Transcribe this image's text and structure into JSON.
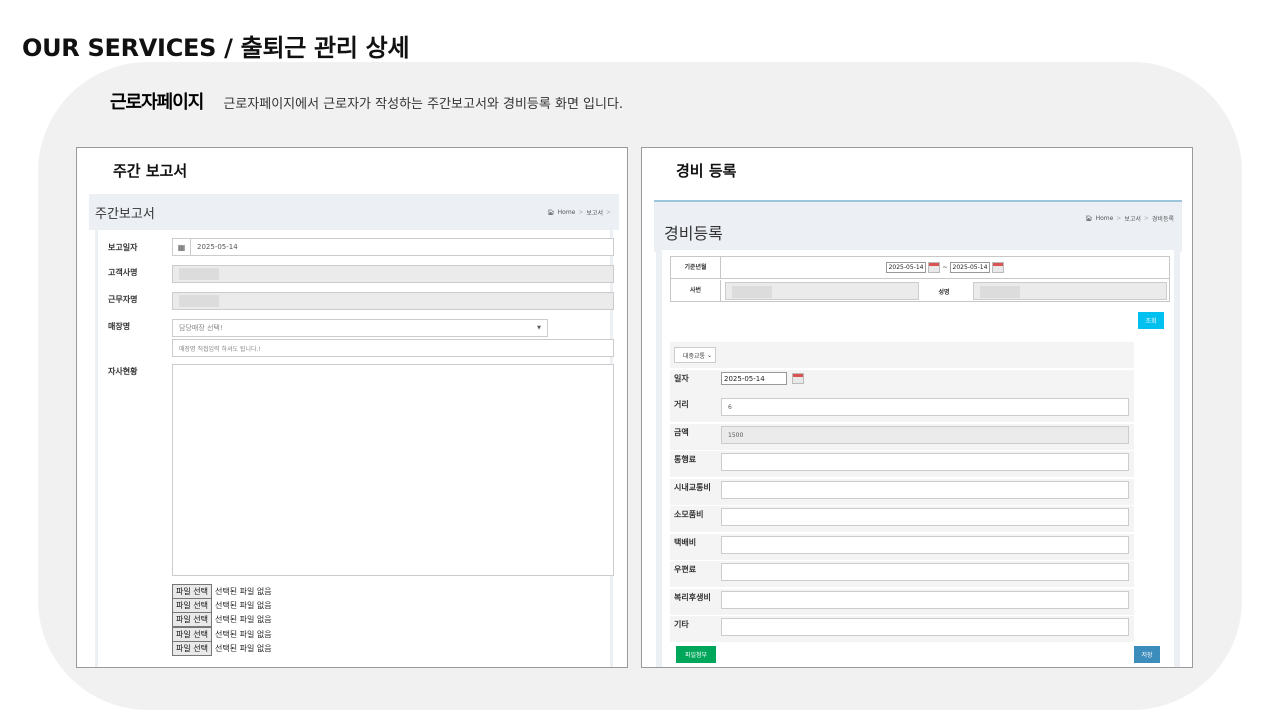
{
  "page": {
    "title": "OUR SERVICES / 출퇴근 관리 상세",
    "intro_label": "근로자페이지",
    "intro_desc": "근로자페이지에서 근로자가 작성하는 주간보고서와 경비등록 화면 입니다."
  },
  "weekly": {
    "heading": "주간 보고서",
    "header_title": "주간보고서",
    "breadcrumb": {
      "home": "Home",
      "current": "보고서"
    },
    "fields": {
      "report_date_label": "보고일자",
      "report_date_value": "2025-05-14",
      "client_label": "고객사명",
      "worker_label": "근무자명",
      "store_label": "매장명",
      "store_select_placeholder": "담당매장 선택!",
      "store_direct_placeholder": "매장명 직접입력 하셔도 됩니다.!",
      "status_label": "자사현황"
    },
    "files": [
      {
        "button": "파일 선택",
        "status": "선택된 파일 없음"
      },
      {
        "button": "파일 선택",
        "status": "선택된 파일 없음"
      },
      {
        "button": "파일 선택",
        "status": "선택된 파일 없음"
      },
      {
        "button": "파일 선택",
        "status": "선택된 파일 없음"
      },
      {
        "button": "파일 선택",
        "status": "선택된 파일 없음"
      }
    ]
  },
  "expense": {
    "heading": "경비 등록",
    "header_title": "경비등록",
    "breadcrumb": {
      "home": "Home",
      "mid": "보고서",
      "current": "경비등록"
    },
    "query": {
      "base_month_label": "기준년월",
      "date_from": "2025-05-14",
      "date_sep": "~",
      "date_to": "2025-05-14",
      "emp_no_label": "사번",
      "name_label": "성명",
      "search_button": "조회"
    },
    "transport_select": "대중교통",
    "form": {
      "date_label": "일자",
      "date_value": "2025-05-14",
      "distance_label": "거리",
      "distance_value": "6",
      "amount_label": "금액",
      "amount_value": "1500",
      "toll_label": "통행료",
      "local_transport_label": "시내교통비",
      "supplies_label": "소모품비",
      "delivery_label": "택배비",
      "postage_label": "우편료",
      "welfare_label": "복리후생비",
      "other_label": "기타"
    },
    "attach_button": "파일첨부",
    "save_button": "저장"
  }
}
